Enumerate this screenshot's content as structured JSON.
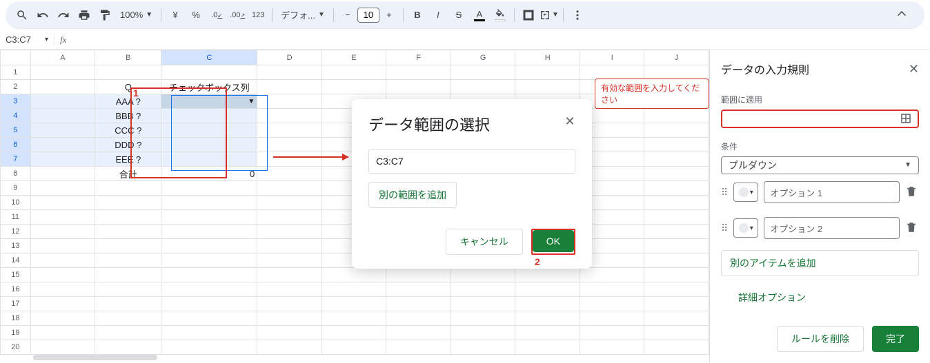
{
  "toolbar": {
    "zoom": "100%",
    "currency": "¥",
    "percent": "%",
    "dec_dec": ".0",
    "inc_dec": ".00",
    "num_fmt": "123",
    "font": "デフォ...",
    "font_size": "10"
  },
  "namebox": {
    "value": "C3:C7"
  },
  "columns": [
    "A",
    "B",
    "C",
    "D",
    "E",
    "F",
    "G",
    "H",
    "I",
    "J"
  ],
  "rows_count": 20,
  "cells": {
    "B2": "Q",
    "C2": "チェックボックス列",
    "B3": "AAA ?",
    "B4": "BBB ?",
    "B5": "CCC ?",
    "B6": "DDD ?",
    "B7": "EEE ?",
    "B8": "合計",
    "C8": "0"
  },
  "annotations": {
    "one": "1",
    "two": "2"
  },
  "warning": "有効な範囲を入力してください",
  "dialog": {
    "title": "データ範囲の選択",
    "range_value": "C3:C7",
    "add_range": "別の範囲を追加",
    "cancel": "キャンセル",
    "ok": "OK"
  },
  "sidebar": {
    "title": "データの入力規則",
    "apply_to": "範囲に適用",
    "condition": "条件",
    "condition_value": "プルダウン",
    "option1": "オプション 1",
    "option2": "オプション 2",
    "add_item": "別のアイテムを追加",
    "advanced": "詳細オプション",
    "delete_rule": "ルールを削除",
    "done": "完了"
  }
}
